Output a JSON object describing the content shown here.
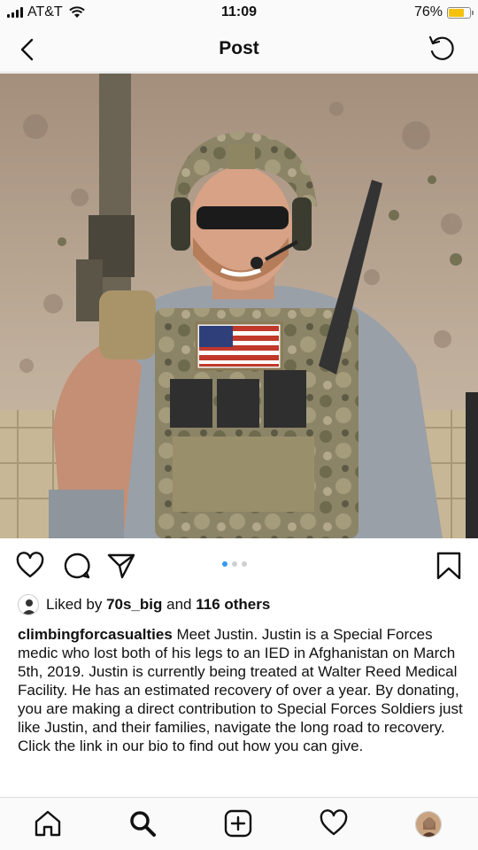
{
  "status_bar": {
    "carrier": "AT&T",
    "time": "11:09",
    "battery": "76%",
    "battery_level": 0.76
  },
  "nav": {
    "title": "Post",
    "back_icon": "chevron-left-icon",
    "refresh_icon": "refresh-icon"
  },
  "post": {
    "image_alt": "Soldier in camouflage gear with helmet, sunglasses and American flag patch",
    "carousel": {
      "current": 1,
      "total": 3
    }
  },
  "likes": {
    "prefix": "Liked by",
    "user": "70s_big",
    "conjunction": "and",
    "others": "116 others"
  },
  "caption": {
    "username": "climbingforcasualties",
    "text": "Meet Justin. Justin is a Special Forces medic who lost both of his legs to an IED in Afghanistan on March 5th, 2019. Justin is currently being treated at Walter Reed Medical Facility. He has an estimated recovery of over a year. By donating, you are making a direct contribution to Special Forces Soldiers just like Justin, and their families, navigate the long road to recovery. Click the link in our bio to find out how you can give."
  },
  "colors": {
    "accent": "#3897f0",
    "battery": "#f4c20d",
    "text": "#111111",
    "bar_bg": "#fafafa"
  },
  "tab_bar": {
    "items": [
      "home-icon",
      "search-icon",
      "add-post-icon",
      "activity-heart-icon",
      "profile-avatar"
    ]
  }
}
